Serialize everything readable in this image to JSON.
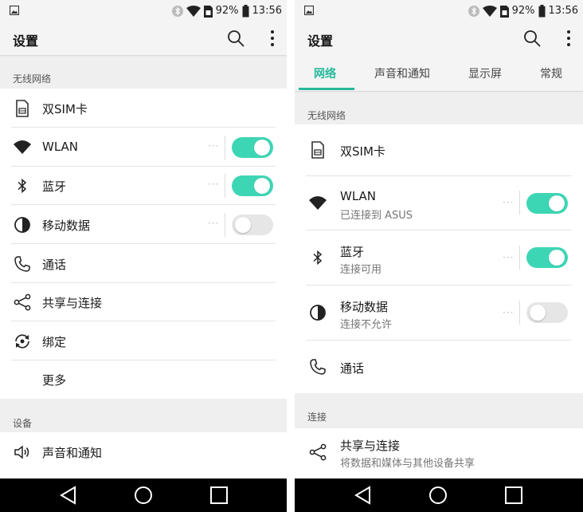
{
  "status": {
    "battery": "92%",
    "time": "13:56"
  },
  "left": {
    "title": "设置",
    "section_wireless": "无线网络",
    "section_device": "设备",
    "rows": [
      {
        "label": "双SIM卡"
      },
      {
        "label": "WLAN",
        "toggle": "on"
      },
      {
        "label": "蓝牙",
        "toggle": "on"
      },
      {
        "label": "移动数据",
        "toggle": "off"
      },
      {
        "label": "通话"
      },
      {
        "label": "共享与连接"
      },
      {
        "label": "绑定"
      },
      {
        "label": "更多"
      }
    ],
    "device_rows": [
      {
        "label": "声音和通知"
      }
    ]
  },
  "right": {
    "title": "设置",
    "tabs": [
      {
        "label": "网络",
        "active": true
      },
      {
        "label": "声音和通知"
      },
      {
        "label": "显示屏"
      },
      {
        "label": "常规"
      }
    ],
    "section_wireless": "无线网络",
    "section_connect": "连接",
    "rows": [
      {
        "label": "双SIM卡"
      },
      {
        "label": "WLAN",
        "sub": "已连接到 ASUS",
        "toggle": "on"
      },
      {
        "label": "蓝牙",
        "sub": "连接可用",
        "toggle": "on"
      },
      {
        "label": "移动数据",
        "sub": "连接不允许",
        "toggle": "off"
      },
      {
        "label": "通话"
      }
    ],
    "connect_rows": [
      {
        "label": "共享与连接",
        "sub": "将数据和媒体与其他设备共享"
      }
    ]
  },
  "colors": {
    "accent": "#3dd6b5",
    "tab_active": "#27b89a"
  },
  "icons": [
    "picture-icon",
    "bluetooth-icon",
    "wifi-icon",
    "sim-icon",
    "battery-icon",
    "search-icon",
    "more-icon",
    "phone-icon",
    "share-icon",
    "tether-icon",
    "mobile-data-icon",
    "sound-icon",
    "back-icon",
    "home-icon",
    "recents-icon"
  ]
}
